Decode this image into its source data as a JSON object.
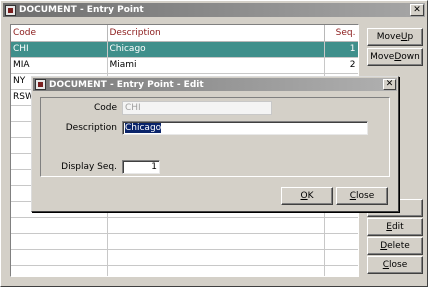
{
  "main_window": {
    "title": "DOCUMENT - Entry Point",
    "close_glyph": "✕"
  },
  "grid": {
    "headers": {
      "code": "Code",
      "description": "Description",
      "seq": "Seq."
    },
    "rows": [
      {
        "code": "CHI",
        "description": "Chicago",
        "seq": "1",
        "selected": true
      },
      {
        "code": "MIA",
        "description": "Miami",
        "seq": "2",
        "selected": false
      },
      {
        "code": "NY",
        "description": "",
        "seq": "",
        "selected": false
      },
      {
        "code": "RSW",
        "description": "",
        "seq": "",
        "selected": false
      },
      {
        "code": "",
        "description": "",
        "seq": "",
        "selected": false
      },
      {
        "code": "",
        "description": "",
        "seq": "",
        "selected": false
      },
      {
        "code": "",
        "description": "",
        "seq": "",
        "selected": false
      },
      {
        "code": "",
        "description": "",
        "seq": "",
        "selected": false
      },
      {
        "code": "",
        "description": "",
        "seq": "",
        "selected": false
      },
      {
        "code": "",
        "description": "",
        "seq": "",
        "selected": false
      },
      {
        "code": "",
        "description": "",
        "seq": "",
        "selected": false
      },
      {
        "code": "",
        "description": "",
        "seq": "",
        "selected": false
      },
      {
        "code": "",
        "description": "",
        "seq": "",
        "selected": false
      },
      {
        "code": "",
        "description": "",
        "seq": "",
        "selected": false
      },
      {
        "code": "",
        "description": "",
        "seq": "",
        "selected": false
      }
    ]
  },
  "side_buttons": {
    "move_up": {
      "pre": "Move ",
      "key": "U",
      "post": "p"
    },
    "move_down": {
      "pre": "Move ",
      "key": "D",
      "post": "own"
    },
    "edit": {
      "pre": "",
      "key": "E",
      "post": "dit"
    },
    "delete": {
      "pre": "",
      "key": "D",
      "post": "elete"
    },
    "close": {
      "pre": "",
      "key": "C",
      "post": "lose"
    }
  },
  "dialog": {
    "title": "DOCUMENT - Entry Point - Edit",
    "close_glyph": "✕",
    "code_label": "Code",
    "code_value": "CHI",
    "description_label": "Description",
    "description_value": "Chicago",
    "display_seq_label": "Display Seq.",
    "display_seq_value": "1",
    "ok": {
      "key": "O",
      "post": "K"
    },
    "close": {
      "key": "C",
      "post": "lose"
    }
  },
  "colors": {
    "selected_row": "#3f8f8b",
    "header_text": "#8b1a1a",
    "text_selection": "#0a246a"
  }
}
